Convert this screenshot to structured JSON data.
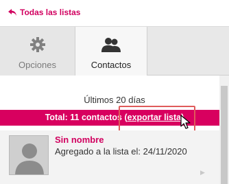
{
  "header": {
    "back_label": "Todas las listas"
  },
  "tabs": [
    {
      "label": "Opciones",
      "icon": "gear-icon",
      "active": false
    },
    {
      "label": "Contactos",
      "icon": "contacts-icon",
      "active": true
    }
  ],
  "summary": {
    "period": "Últimos 20 días",
    "total_prefix": "Total: 11 contactos (",
    "export_link": "exportar lista",
    "total_suffix": ")"
  },
  "contacts": [
    {
      "name": "Sin nombre",
      "added_text": "Agregado a la lista el: 24/11/2020"
    }
  ],
  "colors": {
    "accent": "#d8005f",
    "highlight_box": "#e05a5a"
  }
}
